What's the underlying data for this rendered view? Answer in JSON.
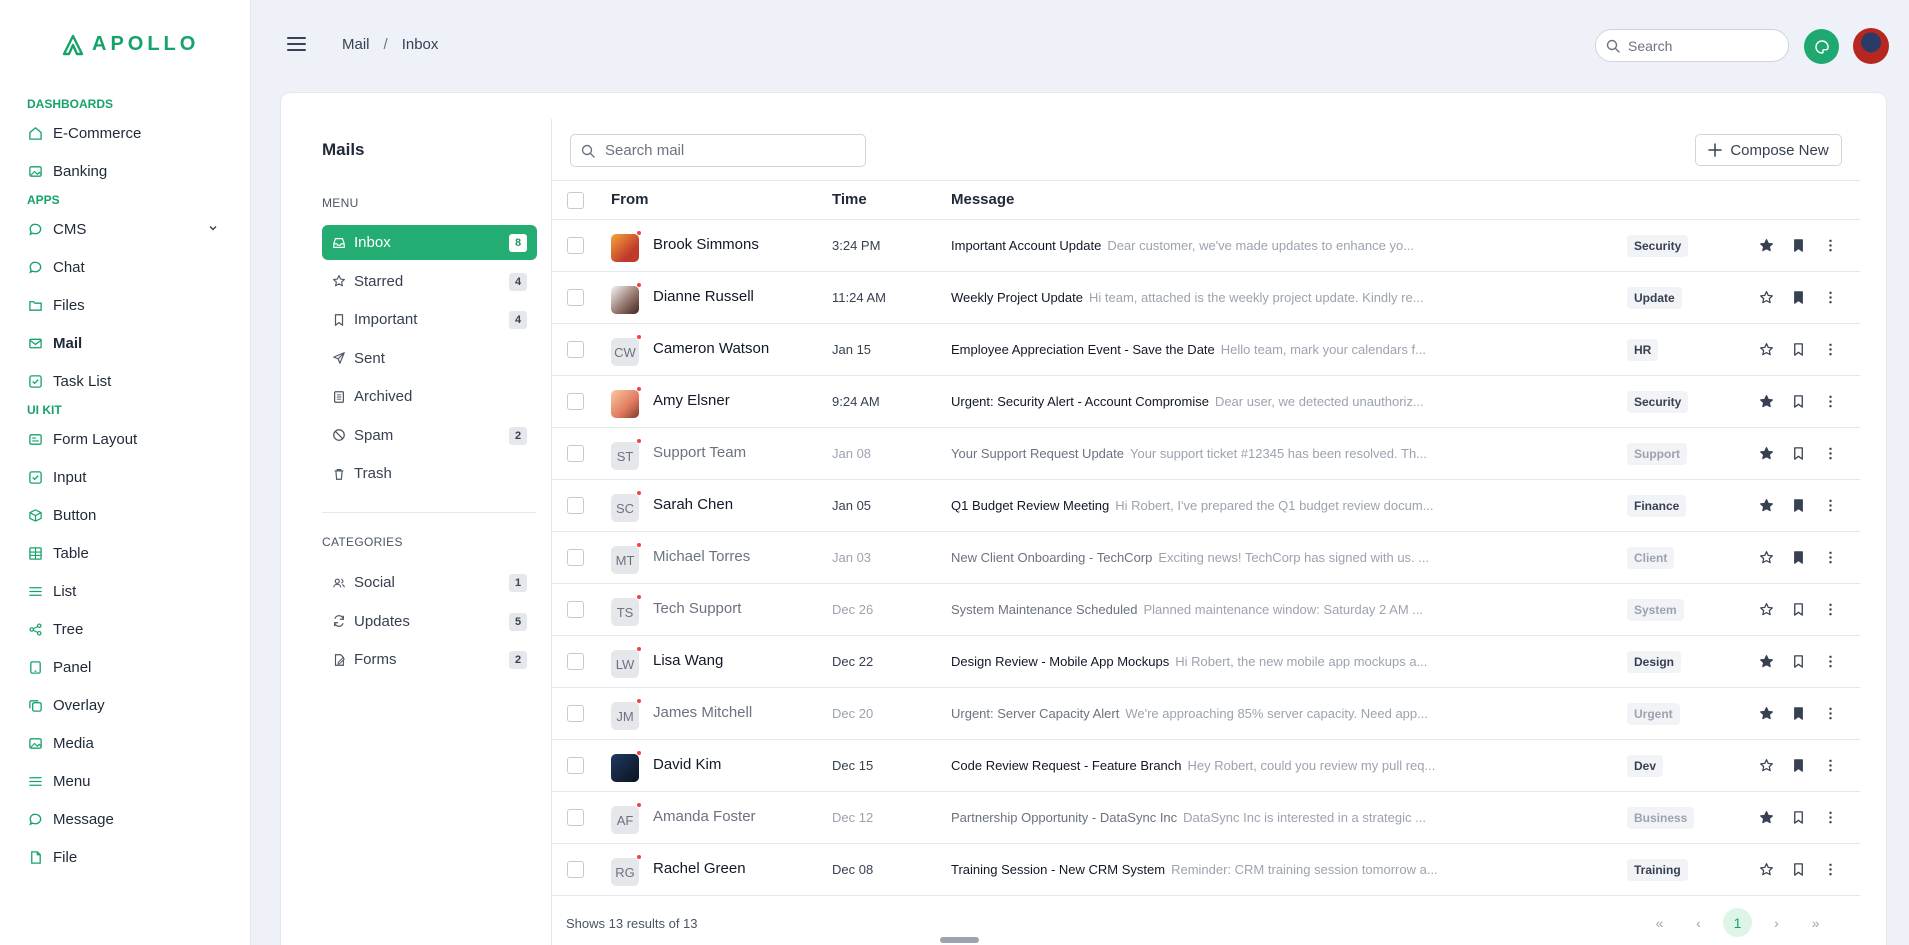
{
  "brand": {
    "name": "APOLLO",
    "color": "#16a36a"
  },
  "sidebar": {
    "sections": [
      {
        "title": "DASHBOARDS",
        "items": [
          {
            "label": "E-Commerce",
            "icon": "home-icon"
          },
          {
            "label": "Banking",
            "icon": "image-icon"
          }
        ]
      },
      {
        "title": "APPS",
        "items": [
          {
            "label": "CMS",
            "icon": "chat-bubble-icon",
            "expandable": true
          },
          {
            "label": "Chat",
            "icon": "chat-icon"
          },
          {
            "label": "Files",
            "icon": "folder-icon"
          },
          {
            "label": "Mail",
            "icon": "mail-icon",
            "active": true
          },
          {
            "label": "Task List",
            "icon": "check-square-icon"
          }
        ]
      },
      {
        "title": "UI KIT",
        "items": [
          {
            "label": "Form Layout",
            "icon": "id-card-icon"
          },
          {
            "label": "Input",
            "icon": "check-square-icon"
          },
          {
            "label": "Button",
            "icon": "box-icon"
          },
          {
            "label": "Table",
            "icon": "table-icon"
          },
          {
            "label": "List",
            "icon": "list-icon"
          },
          {
            "label": "Tree",
            "icon": "share-icon"
          },
          {
            "label": "Panel",
            "icon": "tablet-icon"
          },
          {
            "label": "Overlay",
            "icon": "copy-icon"
          },
          {
            "label": "Media",
            "icon": "image-icon"
          },
          {
            "label": "Menu",
            "icon": "menu-icon"
          },
          {
            "label": "Message",
            "icon": "chat-icon"
          },
          {
            "label": "File",
            "icon": "file-icon"
          }
        ]
      }
    ]
  },
  "topbar": {
    "breadcrumb": [
      "Mail",
      "Inbox"
    ],
    "search_placeholder": "Search"
  },
  "mail": {
    "title": "Mails",
    "menu_heading": "MENU",
    "folders": [
      {
        "label": "Inbox",
        "count": "8",
        "icon": "inbox-icon",
        "active": true
      },
      {
        "label": "Starred",
        "count": "4",
        "icon": "star-icon"
      },
      {
        "label": "Important",
        "count": "4",
        "icon": "bookmark-icon"
      },
      {
        "label": "Sent",
        "count": "",
        "icon": "send-icon"
      },
      {
        "label": "Archived",
        "count": "",
        "icon": "archive-icon"
      },
      {
        "label": "Spam",
        "count": "2",
        "icon": "ban-icon"
      },
      {
        "label": "Trash",
        "count": "",
        "icon": "trash-icon"
      }
    ],
    "categories_heading": "CATEGORIES",
    "categories": [
      {
        "label": "Social",
        "count": "1",
        "icon": "users-icon"
      },
      {
        "label": "Updates",
        "count": "5",
        "icon": "refresh-icon"
      },
      {
        "label": "Forms",
        "count": "2",
        "icon": "form-icon"
      }
    ],
    "search_placeholder": "Search mail",
    "compose_label": "Compose New",
    "columns": {
      "from": "From",
      "time": "Time",
      "message": "Message"
    },
    "rows": [
      {
        "from": "Brook Simmons",
        "avatar": "photo1",
        "initials": "",
        "time": "3:24 PM",
        "subject": "Important Account Update",
        "preview": "Dear customer, we've made updates to enhance yo...",
        "tag": "Security",
        "starred": true,
        "bookmarked": true,
        "unread": true
      },
      {
        "from": "Dianne Russell",
        "avatar": "photo2",
        "initials": "",
        "time": "11:24 AM",
        "subject": "Weekly Project Update",
        "preview": "Hi team, attached is the weekly project update. Kindly re...",
        "tag": "Update",
        "starred": false,
        "bookmarked": true,
        "unread": true
      },
      {
        "from": "Cameron Watson",
        "avatar": "",
        "initials": "CW",
        "time": "Jan 15",
        "subject": "Employee Appreciation Event - Save the Date",
        "preview": "Hello team, mark your calendars f...",
        "tag": "HR",
        "starred": false,
        "bookmarked": false,
        "unread": true
      },
      {
        "from": "Amy Elsner",
        "avatar": "photo3",
        "initials": "",
        "time": "9:24 AM",
        "subject": "Urgent: Security Alert - Account Compromise",
        "preview": "Dear user, we detected unauthoriz...",
        "tag": "Security",
        "starred": true,
        "bookmarked": false,
        "unread": true
      },
      {
        "from": "Support Team",
        "avatar": "",
        "initials": "ST",
        "time": "Jan 08",
        "subject": "Your Support Request Update",
        "preview": "Your support ticket #12345 has been resolved. Th...",
        "tag": "Support",
        "starred": true,
        "bookmarked": false,
        "unread": false
      },
      {
        "from": "Sarah Chen",
        "avatar": "",
        "initials": "SC",
        "time": "Jan 05",
        "subject": "Q1 Budget Review Meeting",
        "preview": "Hi Robert, I've prepared the Q1 budget review docum...",
        "tag": "Finance",
        "starred": true,
        "bookmarked": true,
        "unread": true
      },
      {
        "from": "Michael Torres",
        "avatar": "",
        "initials": "MT",
        "time": "Jan 03",
        "subject": "New Client Onboarding - TechCorp",
        "preview": "Exciting news! TechCorp has signed with us. ...",
        "tag": "Client",
        "starred": false,
        "bookmarked": true,
        "unread": false
      },
      {
        "from": "Tech Support",
        "avatar": "",
        "initials": "TS",
        "time": "Dec 26",
        "subject": "System Maintenance Scheduled",
        "preview": "Planned maintenance window: Saturday 2 AM ...",
        "tag": "System",
        "starred": false,
        "bookmarked": false,
        "unread": false
      },
      {
        "from": "Lisa Wang",
        "avatar": "",
        "initials": "LW",
        "time": "Dec 22",
        "subject": "Design Review - Mobile App Mockups",
        "preview": "Hi Robert, the new mobile app mockups a...",
        "tag": "Design",
        "starred": true,
        "bookmarked": false,
        "unread": true
      },
      {
        "from": "James Mitchell",
        "avatar": "",
        "initials": "JM",
        "time": "Dec 20",
        "subject": "Urgent: Server Capacity Alert",
        "preview": "We're approaching 85% server capacity. Need app...",
        "tag": "Urgent",
        "starred": true,
        "bookmarked": true,
        "unread": false
      },
      {
        "from": "David Kim",
        "avatar": "photo4",
        "initials": "",
        "time": "Dec 15",
        "subject": "Code Review Request - Feature Branch",
        "preview": "Hey Robert, could you review my pull req...",
        "tag": "Dev",
        "starred": false,
        "bookmarked": true,
        "unread": true
      },
      {
        "from": "Amanda Foster",
        "avatar": "",
        "initials": "AF",
        "time": "Dec 12",
        "subject": "Partnership Opportunity - DataSync Inc",
        "preview": "DataSync Inc is interested in a strategic ...",
        "tag": "Business",
        "starred": true,
        "bookmarked": false,
        "unread": false
      },
      {
        "from": "Rachel Green",
        "avatar": "",
        "initials": "RG",
        "time": "Dec 08",
        "subject": "Training Session - New CRM System",
        "preview": "Reminder: CRM training session tomorrow a...",
        "tag": "Training",
        "starred": false,
        "bookmarked": false,
        "unread": true
      }
    ],
    "footer": "Shows 13 results of 13",
    "pager": {
      "current": "1"
    }
  }
}
